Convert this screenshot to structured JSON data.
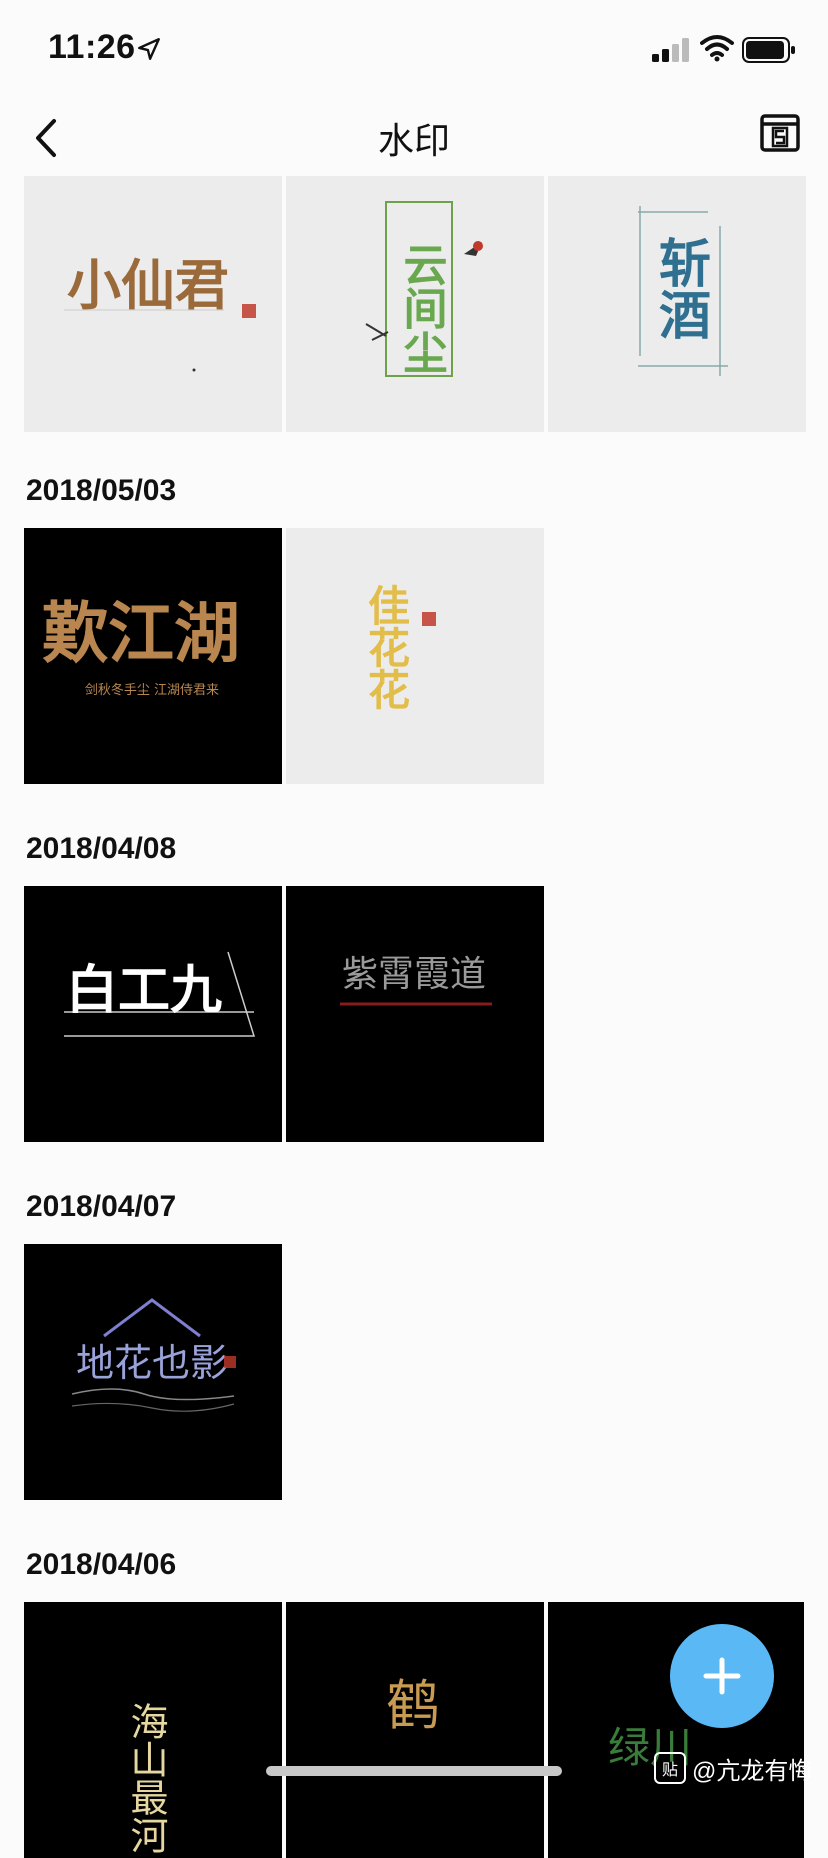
{
  "status_bar": {
    "time": "11:26"
  },
  "nav": {
    "title": "水印"
  },
  "sections": [
    {
      "date": ""
    },
    {
      "date": "2018/05/03"
    },
    {
      "date": "2018/04/08"
    },
    {
      "date": "2018/04/07"
    },
    {
      "date": "2018/04/06"
    }
  ],
  "thumbnails": {
    "t1": "小仙君",
    "t2": "云间尘",
    "t3": "斩酒",
    "t4": "歎江湖",
    "t4_sub": "剑秋冬手尘 江湖侍君来",
    "t5": "佳花花",
    "t6": "白工九",
    "t7": "紫霄霞道",
    "t8": "地花也影",
    "t9": "海山最河",
    "t10": "鹤",
    "t11": "绿川"
  },
  "watermark": {
    "text": "@亢龙有悔"
  },
  "colors": {
    "fab": "#5ab9f5",
    "background": "#fbfbfb"
  }
}
